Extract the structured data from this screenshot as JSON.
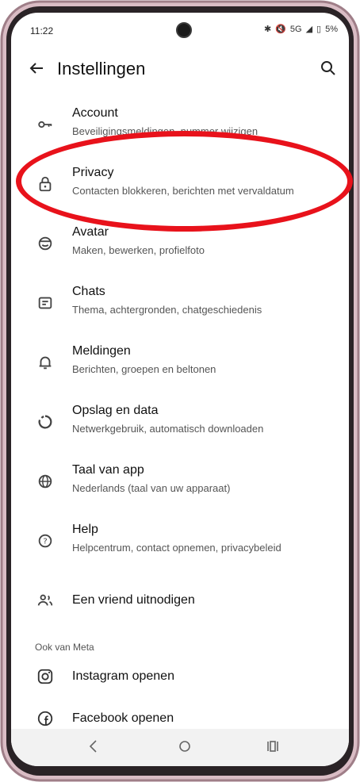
{
  "status": {
    "time": "11:22",
    "icons_text": "5G",
    "battery": "5%"
  },
  "app_bar": {
    "title": "Instellingen"
  },
  "items": [
    {
      "title": "Account",
      "subtitle": "Beveiligingsmeldingen, nummer wijzigen",
      "icon": "key-icon"
    },
    {
      "title": "Privacy",
      "subtitle": "Contacten blokkeren, berichten met vervaldatum",
      "icon": "lock-icon"
    },
    {
      "title": "Avatar",
      "subtitle": "Maken, bewerken, profielfoto",
      "icon": "avatar-icon"
    },
    {
      "title": "Chats",
      "subtitle": "Thema, achtergronden, chatgeschiedenis",
      "icon": "chat-icon"
    },
    {
      "title": "Meldingen",
      "subtitle": "Berichten, groepen en beltonen",
      "icon": "bell-icon"
    },
    {
      "title": "Opslag en data",
      "subtitle": "Netwerkgebruik, automatisch downloaden",
      "icon": "storage-icon"
    },
    {
      "title": "Taal van app",
      "subtitle": "Nederlands (taal van uw apparaat)",
      "icon": "globe-icon"
    },
    {
      "title": "Help",
      "subtitle": "Helpcentrum, contact opnemen, privacybeleid",
      "icon": "help-icon"
    },
    {
      "title": "Een vriend uitnodigen",
      "icon": "invite-friends-icon"
    }
  ],
  "meta_section": {
    "label": "Ook van Meta",
    "items": [
      {
        "title": "Instagram openen",
        "icon": "instagram-icon"
      },
      {
        "title": "Facebook openen",
        "icon": "facebook-icon"
      }
    ]
  },
  "colors": {
    "highlight": "#e8121b",
    "frame": "#c9a6b0"
  }
}
